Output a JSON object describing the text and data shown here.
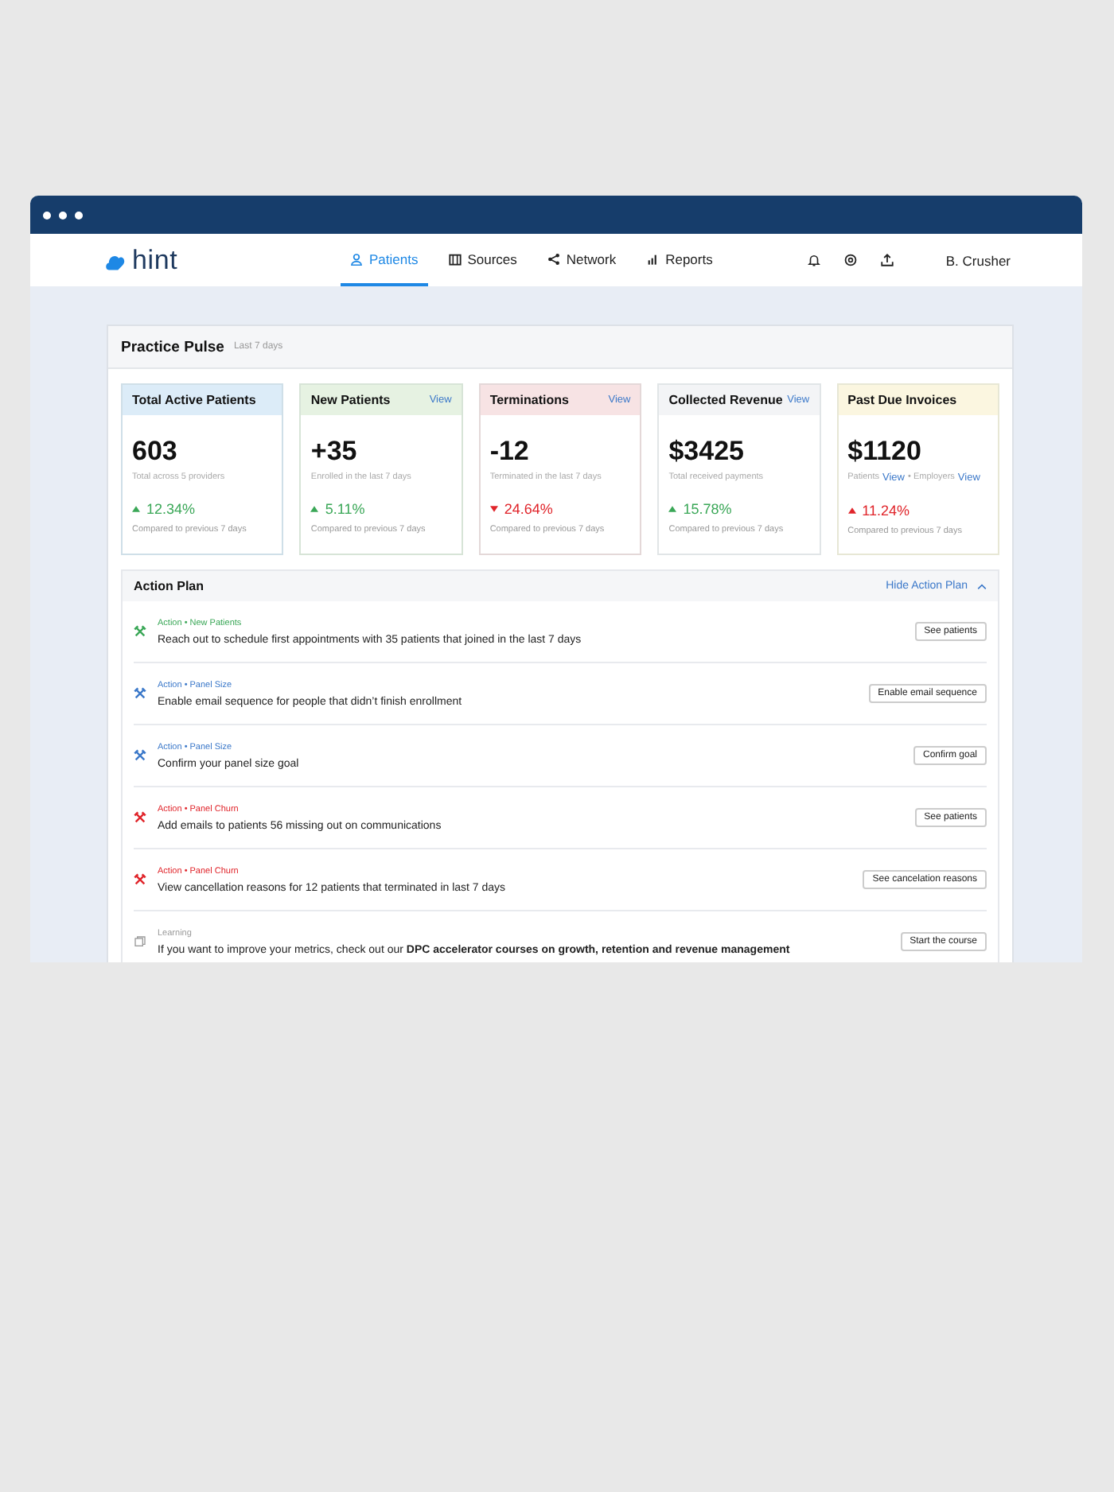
{
  "brand": {
    "name": "hint"
  },
  "nav": [
    {
      "label": "Patients",
      "selected": true
    },
    {
      "label": "Sources",
      "selected": false
    },
    {
      "label": "Network",
      "selected": false
    },
    {
      "label": "Reports",
      "selected": false
    }
  ],
  "user": "B. Crusher",
  "pulse": {
    "title": "Practice Pulse",
    "subtitle": "Last 7 days",
    "metrics": [
      {
        "label": "Total Active Patients",
        "color": "#dcecf8",
        "value": "603",
        "sub": [
          {
            "text": "Total across 5 providers",
            "link": false
          }
        ],
        "kind": "increase",
        "favorable": true,
        "change": "12.34%",
        "compare": "Compared to previous 7 days"
      },
      {
        "label": "New Patients",
        "color": "#e6f2e2",
        "link": "View",
        "value": "+35",
        "sub": [
          {
            "text": "Enrolled in the last 7 days",
            "link": false
          }
        ],
        "kind": "increase",
        "favorable": true,
        "change": "5.11%",
        "compare": "Compared to previous 7 days"
      },
      {
        "label": "Terminations",
        "color": "#f7e3e4",
        "link": "View",
        "value": "-12",
        "sub": [
          {
            "text": "Terminated in the last 7 days",
            "link": false
          }
        ],
        "kind": "decrease",
        "favorable": false,
        "change": "24.64%",
        "compare": "Compared to previous 7 days"
      },
      {
        "label": "Collected Revenue",
        "color": "#f3f4f6",
        "link": "View",
        "value": "$3425",
        "sub": [
          {
            "text": "Total received payments",
            "link": false
          }
        ],
        "kind": "increase",
        "favorable": true,
        "change": "15.78%",
        "compare": "Compared to previous 7 days"
      },
      {
        "label": "Past Due Invoices",
        "color": "#fbf6e0",
        "value": "$1120",
        "sub": [
          {
            "text": "Patients",
            "link": false
          },
          {
            "text": "View",
            "link": true
          },
          {
            "text": "• Employers",
            "link": false
          },
          {
            "text": "View",
            "link": true
          }
        ],
        "kind": "increase",
        "favorable": false,
        "change": "11.24%",
        "compare": "Compared to previous 7 days"
      }
    ]
  },
  "action_plan": {
    "title": "Action Plan",
    "toggle": "Hide Action Plan",
    "expanded": true,
    "items": [
      {
        "kind": "action",
        "category": "Action • New Patients",
        "color": "#3aa757",
        "text": "Reach out to schedule first appointments with 35 patients that joined in the last 7 days",
        "button": "See patients"
      },
      {
        "kind": "action",
        "category": "Action • Panel Size",
        "color": "#3b78c9",
        "text": "Enable email sequence for people that didn’t finish enrollment",
        "button": "Enable email sequence"
      },
      {
        "kind": "action",
        "category": "Action • Panel Size",
        "color": "#3b78c9",
        "text": "Confirm your panel size goal",
        "button": "Confirm goal"
      },
      {
        "kind": "action",
        "category": "Action • Panel Churn",
        "color": "#e0242a",
        "text": "Add emails to patients 56 missing out on communications",
        "button": "See patients"
      },
      {
        "kind": "action",
        "category": "Action • Panel Churn",
        "color": "#e0242a",
        "text": "View cancellation reasons for 12 patients that terminated in last 7 days",
        "button": "See cancelation reasons"
      },
      {
        "kind": "learning",
        "category": "Learning",
        "color": "#9a9a9a",
        "text": "If you want to improve your metrics, check out our **DPC accelerator courses on growth, retention and revenue management**",
        "button": "Start the course"
      }
    ]
  }
}
